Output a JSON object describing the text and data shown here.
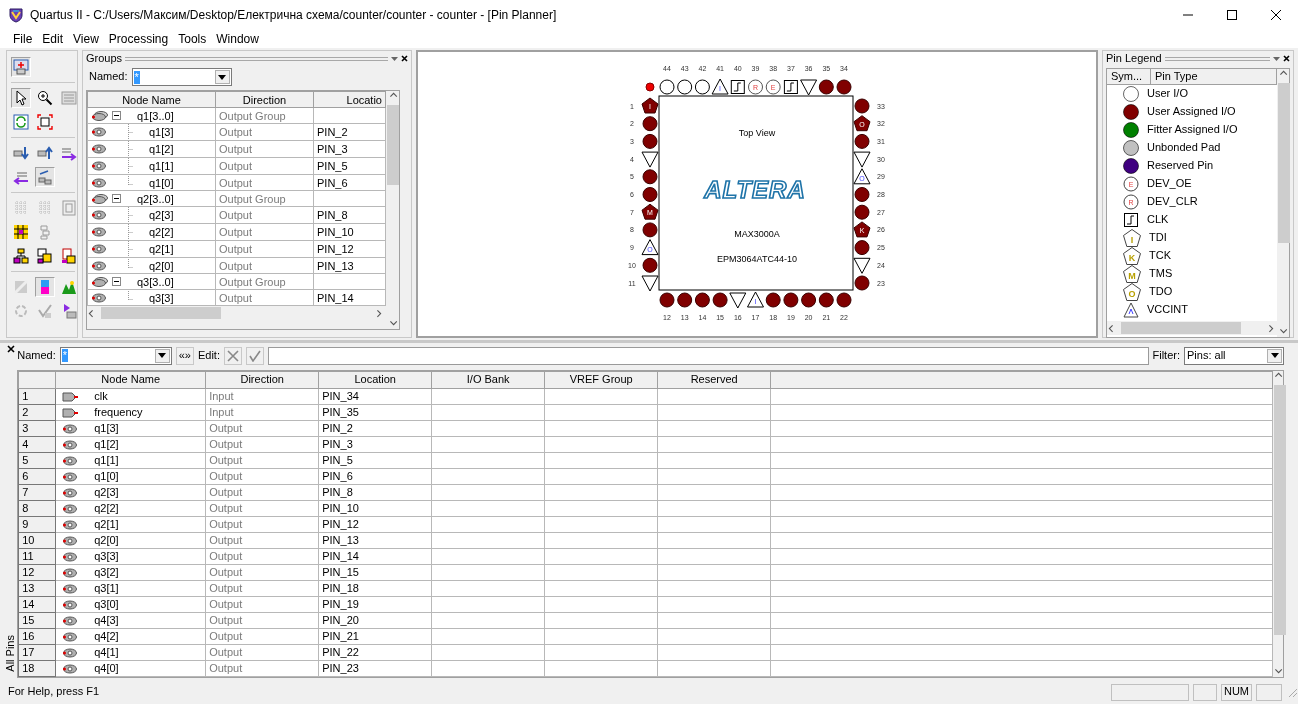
{
  "window": {
    "title": "Quartus II - C:/Users/Максим/Desktop/Електрична схема/counter/counter - counter - [Pin Planner]"
  },
  "menu": [
    "File",
    "Edit",
    "View",
    "Processing",
    "Tools",
    "Window"
  ],
  "tool_buttons": [
    {
      "selected": true
    },
    {
      "selected": true
    },
    {
      "selected": false
    },
    {
      "selected": false
    },
    {
      "selected": false
    },
    {
      "selected": false
    },
    {
      "selected": false
    },
    {
      "selected": false
    },
    {
      "selected": false
    },
    {
      "selected": false
    },
    {
      "selected": true
    },
    {
      "selected": false
    },
    {
      "selected": false
    },
    {
      "selected": false
    },
    {
      "selected": false
    },
    {
      "selected": false
    },
    {
      "selected": false
    },
    {
      "selected": false
    },
    {
      "selected": false
    },
    {
      "selected": false
    },
    {
      "selected": true
    },
    {
      "selected": false
    },
    {
      "selected": false
    },
    {
      "selected": false
    },
    {
      "selected": false
    }
  ],
  "groups_panel": {
    "title": "Groups",
    "named_label": "Named:",
    "named_value": "*",
    "columns": [
      "Node Name",
      "Direction",
      "Locatio"
    ],
    "rows": [
      {
        "name": "q1[3..0]",
        "direction": "Output Group",
        "expanded": true,
        "children": [
          {
            "name": "q1[3]",
            "direction": "Output",
            "location": "PIN_2"
          },
          {
            "name": "q1[2]",
            "direction": "Output",
            "location": "PIN_3"
          },
          {
            "name": "q1[1]",
            "direction": "Output",
            "location": "PIN_5"
          },
          {
            "name": "q1[0]",
            "direction": "Output",
            "location": "PIN_6"
          }
        ]
      },
      {
        "name": "q2[3..0]",
        "direction": "Output Group",
        "expanded": true,
        "children": [
          {
            "name": "q2[3]",
            "direction": "Output",
            "location": "PIN_8"
          },
          {
            "name": "q2[2]",
            "direction": "Output",
            "location": "PIN_10"
          },
          {
            "name": "q2[1]",
            "direction": "Output",
            "location": "PIN_12"
          },
          {
            "name": "q2[0]",
            "direction": "Output",
            "location": "PIN_13"
          }
        ]
      },
      {
        "name": "q3[3..0]",
        "direction": "Output Group",
        "expanded": true,
        "children": [
          {
            "name": "q3[3]",
            "direction": "Output",
            "location": "PIN_14"
          }
        ]
      }
    ]
  },
  "pin_view": {
    "label": "Top View",
    "logo": "ALTERA",
    "family": "MAX3000A",
    "device": "EPM3064ATC44-10",
    "pins": {
      "top": [
        {
          "number": "44",
          "kind": "user"
        },
        {
          "number": "43",
          "kind": "user"
        },
        {
          "number": "42",
          "kind": "user"
        },
        {
          "number": "41",
          "kind": "vcc",
          "letter": "I"
        },
        {
          "number": "40",
          "kind": "clk"
        },
        {
          "number": "39",
          "kind": "dev",
          "letter": "R"
        },
        {
          "number": "38",
          "kind": "dev",
          "letter": "E"
        },
        {
          "number": "37",
          "kind": "clk"
        },
        {
          "number": "36",
          "kind": "gnd"
        },
        {
          "number": "35",
          "kind": "assigned"
        },
        {
          "number": "34",
          "kind": "assigned"
        }
      ],
      "left": [
        {
          "number": "1",
          "kind": "jtag",
          "letter": "I"
        },
        {
          "number": "2",
          "kind": "assigned"
        },
        {
          "number": "3",
          "kind": "assigned"
        },
        {
          "number": "4",
          "kind": "gnd"
        },
        {
          "number": "5",
          "kind": "assigned"
        },
        {
          "number": "6",
          "kind": "assigned"
        },
        {
          "number": "7",
          "kind": "jtag",
          "letter": "M"
        },
        {
          "number": "8",
          "kind": "assigned"
        },
        {
          "number": "9",
          "kind": "vcc",
          "letter": "O"
        },
        {
          "number": "10",
          "kind": "assigned"
        },
        {
          "number": "11",
          "kind": "gnd"
        }
      ],
      "bottom": [
        {
          "number": "12",
          "kind": "assigned"
        },
        {
          "number": "13",
          "kind": "assigned"
        },
        {
          "number": "14",
          "kind": "assigned"
        },
        {
          "number": "15",
          "kind": "assigned"
        },
        {
          "number": "16",
          "kind": "gnd"
        },
        {
          "number": "17",
          "kind": "vcc",
          "letter": "I"
        },
        {
          "number": "18",
          "kind": "assigned"
        },
        {
          "number": "19",
          "kind": "assigned"
        },
        {
          "number": "20",
          "kind": "assigned"
        },
        {
          "number": "21",
          "kind": "assigned"
        },
        {
          "number": "22",
          "kind": "assigned"
        }
      ],
      "right": [
        {
          "number": "33",
          "kind": "assigned"
        },
        {
          "number": "32",
          "kind": "jtag",
          "letter": "O"
        },
        {
          "number": "31",
          "kind": "assigned"
        },
        {
          "number": "30",
          "kind": "gnd"
        },
        {
          "number": "29",
          "kind": "vcc",
          "letter": "O"
        },
        {
          "number": "28",
          "kind": "assigned"
        },
        {
          "number": "27",
          "kind": "assigned"
        },
        {
          "number": "26",
          "kind": "jtag",
          "letter": "K"
        },
        {
          "number": "25",
          "kind": "assigned"
        },
        {
          "number": "24",
          "kind": "gnd"
        },
        {
          "number": "23",
          "kind": "assigned"
        }
      ]
    }
  },
  "pin_legend": {
    "title": "Pin Legend",
    "columns": [
      "Sym...",
      "Pin Type"
    ],
    "items": [
      {
        "kind": "dot",
        "color": "#ffffff",
        "label": "User I/O"
      },
      {
        "kind": "dot",
        "color": "#800000",
        "label": "User Assigned I/O"
      },
      {
        "kind": "dot",
        "color": "#008000",
        "label": "Fitter Assigned I/O"
      },
      {
        "kind": "dot",
        "color": "#c0c0c0",
        "label": "Unbonded Pad"
      },
      {
        "kind": "dot",
        "color": "#400080",
        "label": "Reserved Pin"
      },
      {
        "kind": "letter-circle",
        "letter": "E",
        "label": "DEV_OE"
      },
      {
        "kind": "letter-circle",
        "letter": "R",
        "label": "DEV_CLR"
      },
      {
        "kind": "clock",
        "label": "CLK"
      },
      {
        "kind": "pentagon",
        "letter": "I",
        "label": "TDI"
      },
      {
        "kind": "pentagon",
        "letter": "K",
        "label": "TCK"
      },
      {
        "kind": "pentagon",
        "letter": "M",
        "label": "TMS"
      },
      {
        "kind": "pentagon",
        "letter": "O",
        "label": "TDO"
      },
      {
        "kind": "triangle",
        "label": "VCCINT"
      }
    ]
  },
  "pins_table": {
    "tab_label": "All Pins",
    "named_label": "Named:",
    "named_value": "*",
    "expand_button": "«»",
    "edit_label": "Edit:",
    "filter_label": "Filter:",
    "filter_value": "Pins: all",
    "columns": [
      "Node Name",
      "Direction",
      "Location",
      "I/O Bank",
      "VREF Group",
      "Reserved"
    ],
    "rows": [
      {
        "number": "1",
        "kind": "input",
        "name": "clk",
        "direction": "Input",
        "location": "PIN_34"
      },
      {
        "number": "2",
        "kind": "input",
        "name": "frequency",
        "direction": "Input",
        "location": "PIN_35"
      },
      {
        "number": "3",
        "kind": "output",
        "name": "q1[3]",
        "direction": "Output",
        "location": "PIN_2"
      },
      {
        "number": "4",
        "kind": "output",
        "name": "q1[2]",
        "direction": "Output",
        "location": "PIN_3"
      },
      {
        "number": "5",
        "kind": "output",
        "name": "q1[1]",
        "direction": "Output",
        "location": "PIN_5"
      },
      {
        "number": "6",
        "kind": "output",
        "name": "q1[0]",
        "direction": "Output",
        "location": "PIN_6"
      },
      {
        "number": "7",
        "kind": "output",
        "name": "q2[3]",
        "direction": "Output",
        "location": "PIN_8"
      },
      {
        "number": "8",
        "kind": "output",
        "name": "q2[2]",
        "direction": "Output",
        "location": "PIN_10"
      },
      {
        "number": "9",
        "kind": "output",
        "name": "q2[1]",
        "direction": "Output",
        "location": "PIN_12"
      },
      {
        "number": "10",
        "kind": "output",
        "name": "q2[0]",
        "direction": "Output",
        "location": "PIN_13"
      },
      {
        "number": "11",
        "kind": "output",
        "name": "q3[3]",
        "direction": "Output",
        "location": "PIN_14"
      },
      {
        "number": "12",
        "kind": "output",
        "name": "q3[2]",
        "direction": "Output",
        "location": "PIN_15"
      },
      {
        "number": "13",
        "kind": "output",
        "name": "q3[1]",
        "direction": "Output",
        "location": "PIN_18"
      },
      {
        "number": "14",
        "kind": "output",
        "name": "q3[0]",
        "direction": "Output",
        "location": "PIN_19"
      },
      {
        "number": "15",
        "kind": "output",
        "name": "q4[3]",
        "direction": "Output",
        "location": "PIN_20"
      },
      {
        "number": "16",
        "kind": "output",
        "name": "q4[2]",
        "direction": "Output",
        "location": "PIN_21"
      },
      {
        "number": "17",
        "kind": "output",
        "name": "q4[1]",
        "direction": "Output",
        "location": "PIN_22"
      },
      {
        "number": "18",
        "kind": "output",
        "name": "q4[0]",
        "direction": "Output",
        "location": "PIN_23"
      }
    ]
  },
  "status_bar": {
    "help": "For Help, press F1",
    "indicators": [
      "NUM"
    ]
  }
}
